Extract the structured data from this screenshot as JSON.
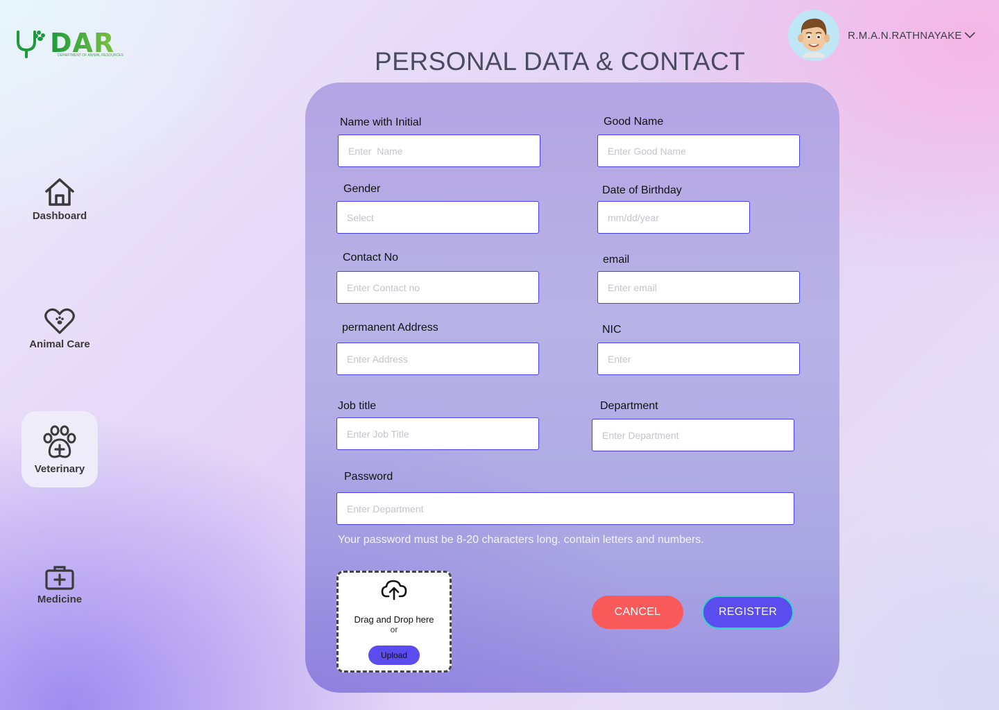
{
  "brand": {
    "name": "DAR",
    "subtitle": "DEPARTMENT OF ANIMAL RESOURCES"
  },
  "header": {
    "title": "PERSONAL DATA & CONTACT",
    "user_name": "R.M.A.N.RATHNAYAKE"
  },
  "sidebar": {
    "items": [
      {
        "label": "Dashboard",
        "icon": "home-icon"
      },
      {
        "label": "Animal Care",
        "icon": "heart-paw-icon"
      },
      {
        "label": "Veterinary",
        "icon": "paw-plus-icon",
        "active": true
      },
      {
        "label": "Medicine",
        "icon": "medical-kit-icon"
      }
    ]
  },
  "form": {
    "name_initial": {
      "label": "Name with Initial",
      "placeholder": "Enter  Name"
    },
    "good_name": {
      "label": "Good  Name",
      "placeholder": "Enter Good Name"
    },
    "gender": {
      "label": "Gender",
      "placeholder": "Select"
    },
    "dob": {
      "label": "Date of Birthday",
      "placeholder": "mm/dd/year"
    },
    "contact": {
      "label": "Contact No",
      "placeholder": "Enter Contact no"
    },
    "email": {
      "label": "email",
      "placeholder": "Enter email"
    },
    "address": {
      "label": "permanent Address",
      "placeholder": "Enter Address"
    },
    "nic": {
      "label": "NIC",
      "placeholder": "Enter"
    },
    "job_title": {
      "label": "Job title",
      "placeholder": "Enter Job Title"
    },
    "department": {
      "label": "Department",
      "placeholder": "Enter Department"
    },
    "password": {
      "label": "Password",
      "placeholder": "Enter Department"
    },
    "password_hint": "Your password must be 8-20 characters long. contain letters and numbers."
  },
  "upload": {
    "text": "Drag and Drop here",
    "or": "or",
    "button": "Upload"
  },
  "actions": {
    "cancel": "CANCEL",
    "register": "REGISTER"
  },
  "colors": {
    "accent": "#5b4cf0",
    "cancel": "#fa5a5a",
    "input_border": "#4a3fe0",
    "brand_green": "#1e9a3c"
  }
}
